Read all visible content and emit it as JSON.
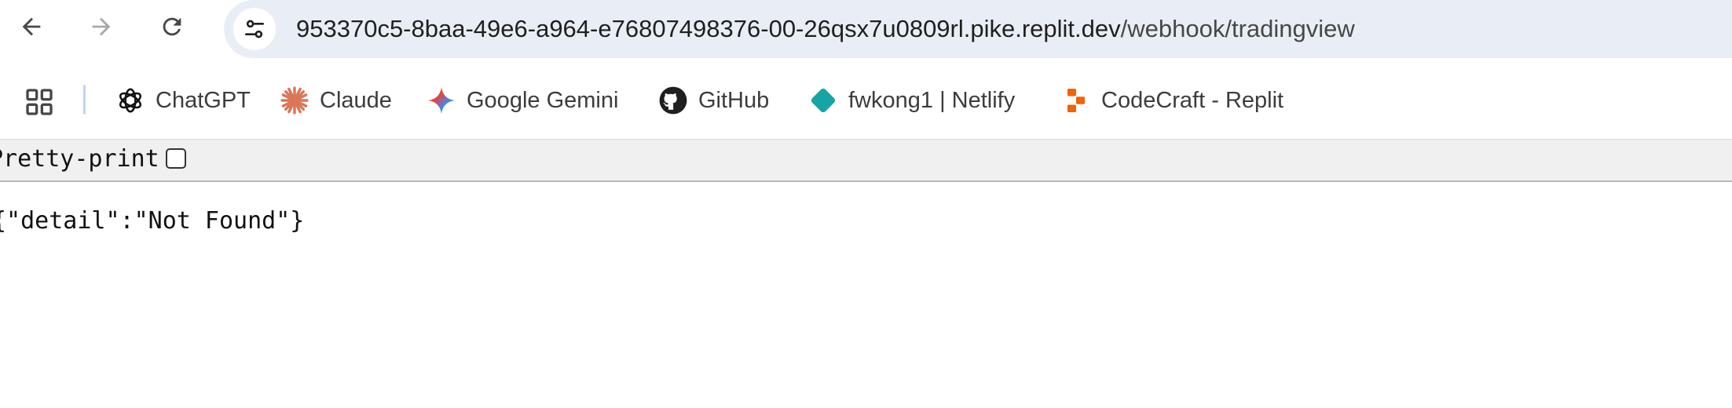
{
  "navigation": {
    "back_icon": "arrow-left-icon",
    "forward_icon": "arrow-right-icon",
    "reload_icon": "reload-icon"
  },
  "omnibox": {
    "site_info_icon": "tune-icon",
    "url_host": "953370c5-8baa-49e6-a964-e76807498376-00-26qsx7u0809rl.pike.replit.dev",
    "url_path": "/webhook/tradingview"
  },
  "bookmarks": {
    "apps_icon": "apps-grid-icon",
    "items": [
      {
        "label": "ChatGPT",
        "icon": "chatgpt-icon"
      },
      {
        "label": "Claude",
        "icon": "claude-icon"
      },
      {
        "label": "Google Gemini",
        "icon": "gemini-icon"
      },
      {
        "label": "GitHub",
        "icon": "github-icon"
      },
      {
        "label": "fwkong1 | Netlify",
        "icon": "netlify-icon"
      },
      {
        "label": "CodeCraft - Replit",
        "icon": "replit-icon"
      }
    ]
  },
  "json_viewer": {
    "pretty_print_label": "Pretty-print",
    "pretty_print_checked": false,
    "body_text": "{\"detail\":\"Not Found\"}"
  },
  "colors": {
    "omnibox_bg": "#e9eef6",
    "pretty_print_bar_bg": "#f0f0f0",
    "claude_accent": "#d97757",
    "netlify_accent": "#15a5a5",
    "replit_accent": "#f26207"
  }
}
